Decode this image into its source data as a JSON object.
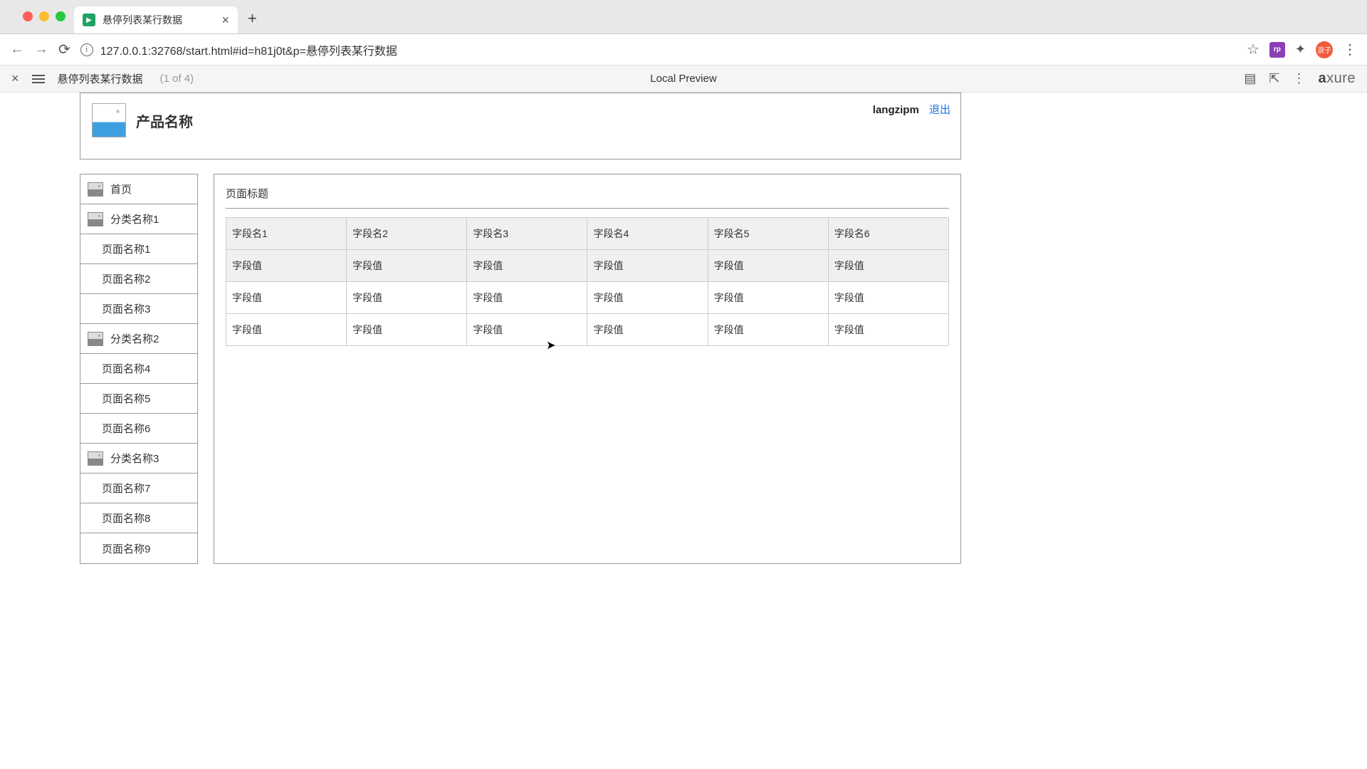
{
  "browser": {
    "tab_title": "悬停列表某行数据",
    "url": "127.0.0.1:32768/start.html#id=h81j0t&p=悬停列表某行数据",
    "extension_label": "rp",
    "avatar_label": "浪子"
  },
  "axure_bar": {
    "page_name": "悬停列表某行数据",
    "page_count": "(1 of 4)",
    "center_label": "Local Preview",
    "logo_prefix": "a",
    "logo_rest": "xure"
  },
  "header": {
    "product_name": "产品名称",
    "username": "langzipm",
    "logout": "退出"
  },
  "sidebar": {
    "items": [
      {
        "type": "cat",
        "label": "首页",
        "icon": true
      },
      {
        "type": "cat",
        "label": "分类名称1",
        "icon": true
      },
      {
        "type": "sub",
        "label": "页面名称1"
      },
      {
        "type": "sub",
        "label": "页面名称2"
      },
      {
        "type": "sub",
        "label": "页面名称3"
      },
      {
        "type": "cat",
        "label": "分类名称2",
        "icon": true
      },
      {
        "type": "sub",
        "label": "页面名称4"
      },
      {
        "type": "sub",
        "label": "页面名称5"
      },
      {
        "type": "sub",
        "label": "页面名称6"
      },
      {
        "type": "cat",
        "label": "分类名称3",
        "icon": true
      },
      {
        "type": "sub",
        "label": "页面名称7"
      },
      {
        "type": "sub",
        "label": "页面名称8"
      },
      {
        "type": "sub",
        "label": "页面名称9"
      }
    ]
  },
  "main": {
    "panel_title": "页面标题",
    "columns": [
      "字段名1",
      "字段名2",
      "字段名3",
      "字段名4",
      "字段名5",
      "字段名6"
    ],
    "rows": [
      [
        "字段值",
        "字段值",
        "字段值",
        "字段值",
        "字段值",
        "字段值"
      ],
      [
        "字段值",
        "字段值",
        "字段值",
        "字段值",
        "字段值",
        "字段值"
      ],
      [
        "字段值",
        "字段值",
        "字段值",
        "字段值",
        "字段值",
        "字段值"
      ]
    ],
    "hover_row": 0
  }
}
